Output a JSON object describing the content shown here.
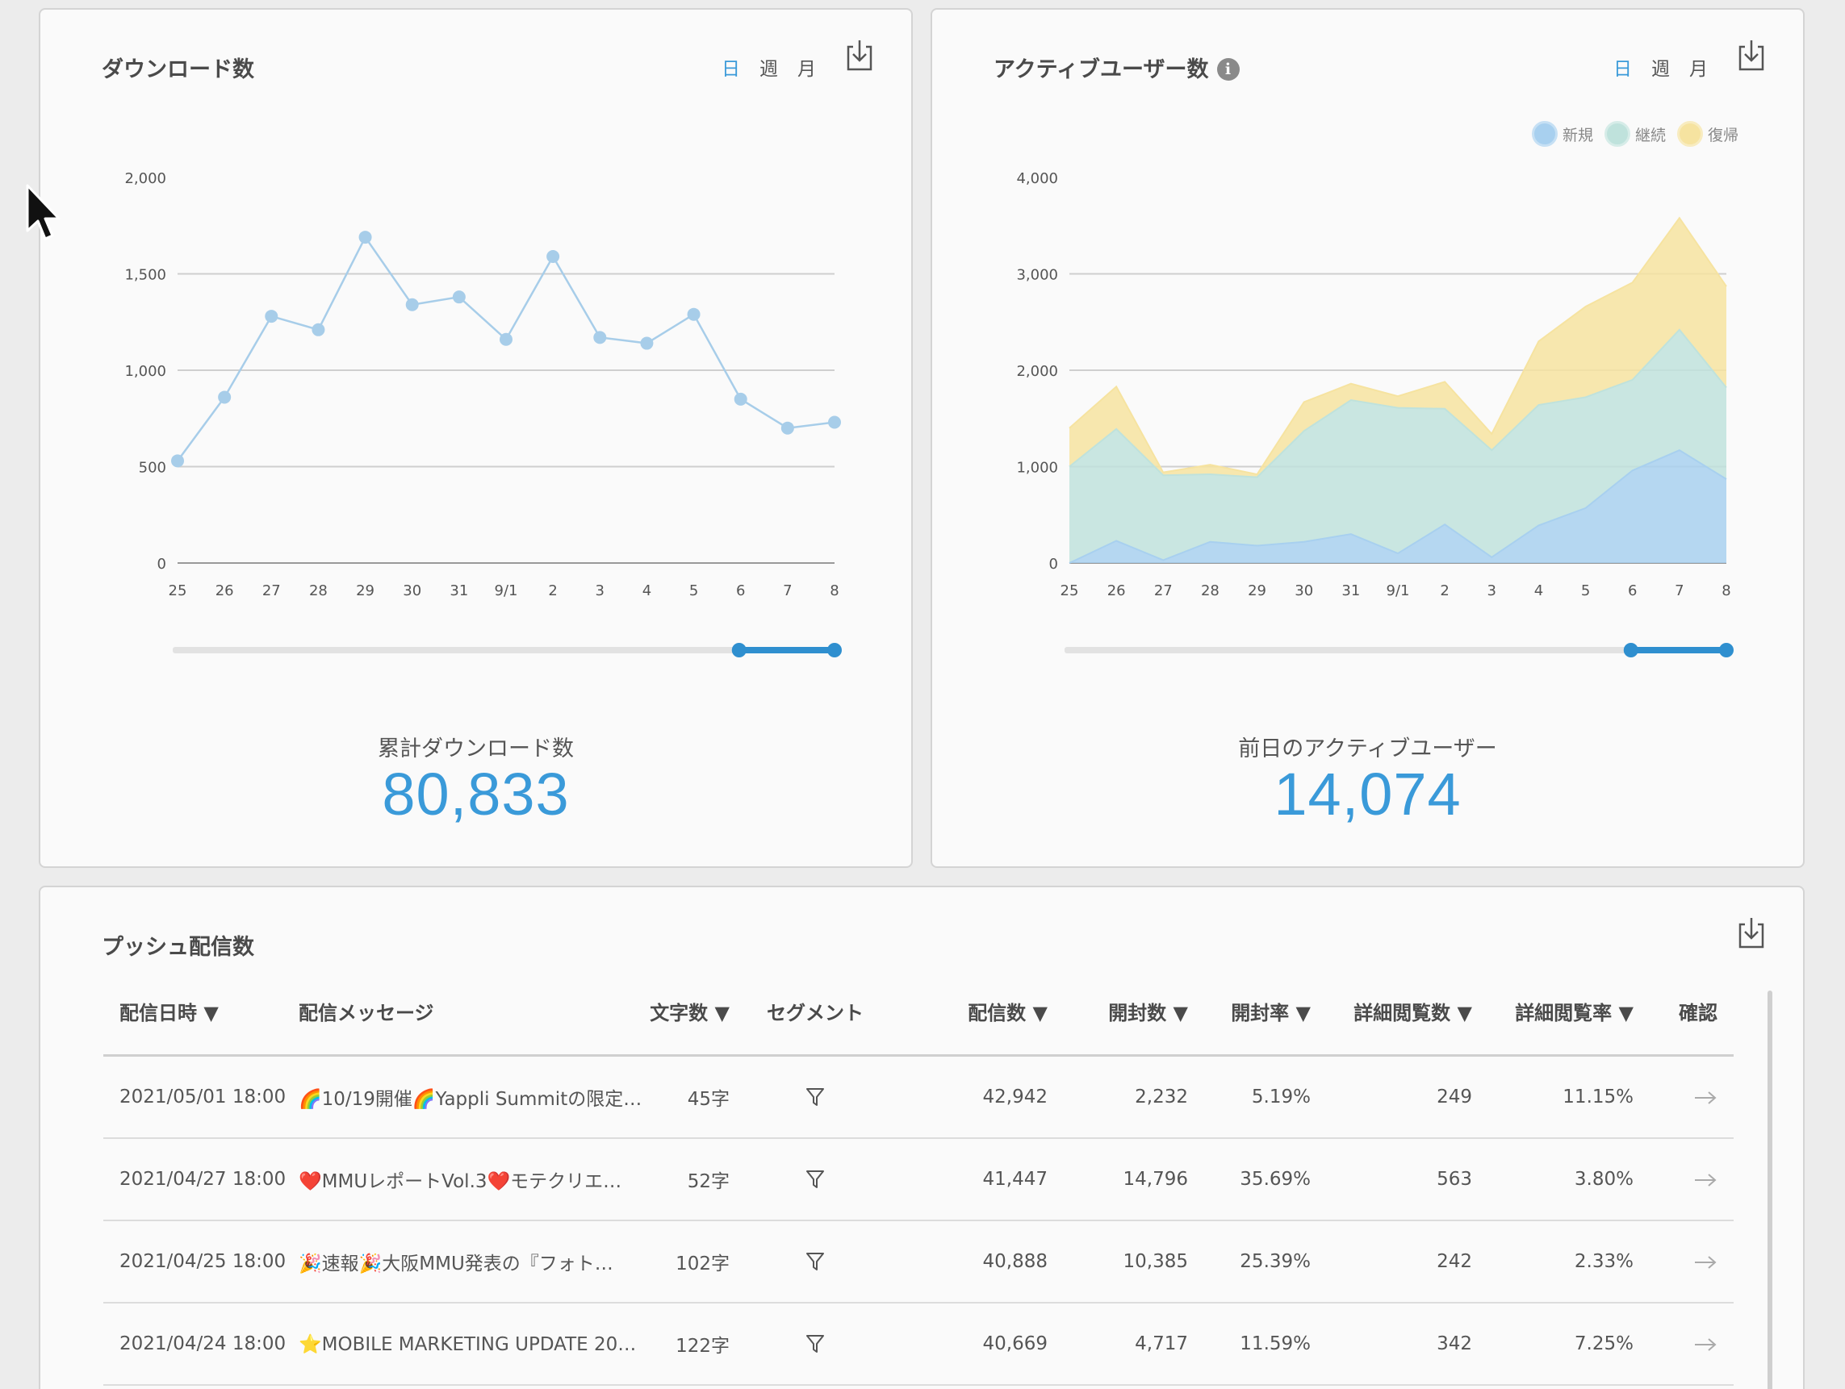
{
  "downloads_card": {
    "title": "ダウンロード数",
    "period_tabs": [
      "日",
      "週",
      "月"
    ],
    "active_tab": "日",
    "download_icon": "download-icon",
    "total_label": "累計ダウンロード数",
    "total_value": "80,833"
  },
  "active_card": {
    "title": "アクティブユーザー数",
    "info_icon": "info-icon",
    "period_tabs": [
      "日",
      "週",
      "月"
    ],
    "active_tab": "日",
    "legend": [
      "新規",
      "継続",
      "復帰"
    ],
    "total_label": "前日のアクティブユーザー",
    "total_value": "14,074"
  },
  "push_card": {
    "title": "プッシュ配信数",
    "columns": [
      "配信日時 ▼",
      "配信メッセージ",
      "文字数 ▼",
      "セグメント",
      "配信数 ▼",
      "開封数 ▼",
      "開封率 ▼",
      "詳細閲覧数 ▼",
      "詳細閲覧率 ▼",
      "確認"
    ],
    "rows": [
      {
        "date": "2021/05/01 18:00",
        "message": "🌈10/19開催🌈Yappli Summitの限定…",
        "chars": "45字",
        "sent": "42,942",
        "opened": "2,232",
        "open_rate": "5.19%",
        "detail_views": "249",
        "detail_rate": "11.15%"
      },
      {
        "date": "2021/04/27 18:00",
        "message": "❤️MMUレポートVol.3❤️モテクリエ…",
        "chars": "52字",
        "sent": "41,447",
        "opened": "14,796",
        "open_rate": "35.69%",
        "detail_views": "563",
        "detail_rate": "3.80%"
      },
      {
        "date": "2021/04/25 18:00",
        "message": "🎉速報🎉大阪MMU発表の『フォト…",
        "chars": "102字",
        "sent": "40,888",
        "opened": "10,385",
        "open_rate": "25.39%",
        "detail_views": "242",
        "detail_rate": "2.33%"
      },
      {
        "date": "2021/04/24 18:00",
        "message": "⭐MOBILE MARKETING UPDATE 201…",
        "chars": "122字",
        "sent": "40,669",
        "opened": "4,717",
        "open_rate": "11.59%",
        "detail_views": "342",
        "detail_rate": "7.25%"
      }
    ]
  },
  "chart_data": [
    {
      "type": "line",
      "x": [
        "25",
        "26",
        "27",
        "28",
        "29",
        "30",
        "31",
        "9/1",
        "2",
        "3",
        "4",
        "5",
        "6",
        "7",
        "8"
      ],
      "series": [
        {
          "values": [
            530,
            860,
            1280,
            1210,
            1690,
            1340,
            1380,
            1160,
            1590,
            1170,
            1140,
            1290,
            850,
            700,
            730
          ],
          "color": "#a7cde9"
        }
      ],
      "y_ticks": [
        "0",
        "500",
        "1,000",
        "1,500",
        "2,000"
      ],
      "ylim": [
        0,
        2000
      ],
      "grid": true,
      "range_slider": {
        "start_fraction": 0.84,
        "end_fraction": 1.0
      }
    },
    {
      "type": "area",
      "stacked": true,
      "x": [
        "25",
        "26",
        "27",
        "28",
        "29",
        "30",
        "31",
        "9/1",
        "2",
        "3",
        "4",
        "5",
        "6",
        "7",
        "8"
      ],
      "series": [
        {
          "name": "新規",
          "color": "#a8d0ef",
          "values": [
            0,
            230,
            30,
            220,
            180,
            220,
            300,
            100,
            400,
            60,
            390,
            570,
            960,
            1170,
            870
          ]
        },
        {
          "name": "継続",
          "color": "#bfe2dc",
          "values": [
            1000,
            1160,
            880,
            700,
            710,
            1150,
            1390,
            1510,
            1200,
            1110,
            1250,
            1150,
            940,
            1250,
            950
          ]
        },
        {
          "name": "復帰",
          "color": "#f6e3a0",
          "values": [
            400,
            440,
            30,
            100,
            30,
            300,
            170,
            120,
            280,
            170,
            660,
            940,
            1010,
            1160,
            1050
          ]
        }
      ],
      "y_ticks": [
        "0",
        "1,000",
        "2,000",
        "3,000",
        "4,000"
      ],
      "ylim": [
        0,
        4000
      ],
      "grid": true,
      "legend_position": "top-right",
      "range_slider": {
        "start_fraction": 0.84,
        "end_fraction": 1.0
      }
    }
  ]
}
